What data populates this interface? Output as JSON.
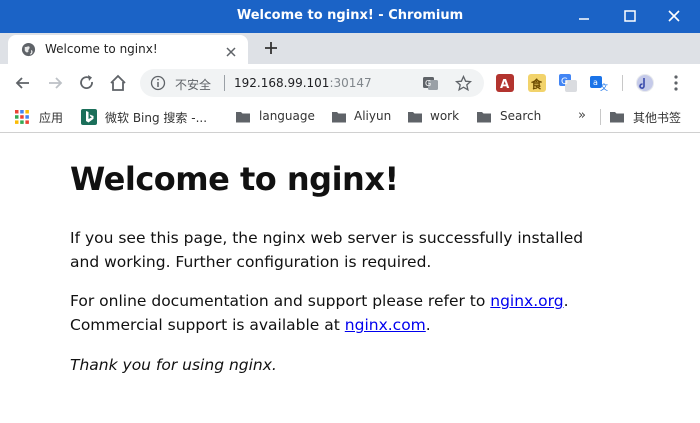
{
  "window": {
    "title": "Welcome to nginx! - Chromium",
    "titlebar_color": "#1b63c6"
  },
  "tabs": [
    {
      "title": "Welcome to nginx!",
      "icon": "globe-icon",
      "active": true
    }
  ],
  "toolbar": {
    "back_icon": "back-arrow-icon",
    "forward_icon": "forward-arrow-icon",
    "reload_icon": "reload-icon",
    "home_icon": "home-icon",
    "omnibox": {
      "security_label": "不安全",
      "url_host": "192.168.99.101",
      "url_port": ":30147"
    },
    "extensions": [
      "acrobat-extension",
      "dictionary-extension",
      "google-translate-extension",
      "translate-extension",
      "media-extension"
    ],
    "menu_icon": "kebab-menu-icon"
  },
  "bookmarks": {
    "items": [
      {
        "label": "应用",
        "icon": "apps-grid-icon"
      },
      {
        "label": "微软 Bing 搜索 -...",
        "icon": "bing-icon"
      },
      {
        "label": "language",
        "icon": "folder-icon"
      },
      {
        "label": "Aliyun",
        "icon": "folder-icon"
      },
      {
        "label": "work",
        "icon": "folder-icon"
      },
      {
        "label": "Search",
        "icon": "folder-icon"
      }
    ],
    "overflow": "»",
    "other": {
      "label": "其他书签",
      "icon": "folder-icon"
    }
  },
  "page": {
    "heading": "Welcome to nginx!",
    "p1": "If you see this page, the nginx web server is successfully installed and working. Further configuration is required.",
    "p2_prefix": "For online documentation and support please refer to ",
    "p2_link1": "nginx.org",
    "p2_mid": ".",
    "p2_line2": "Commercial support is available at ",
    "p2_link2": "nginx.com",
    "p2_suffix": ".",
    "p3": "Thank you for using nginx."
  }
}
